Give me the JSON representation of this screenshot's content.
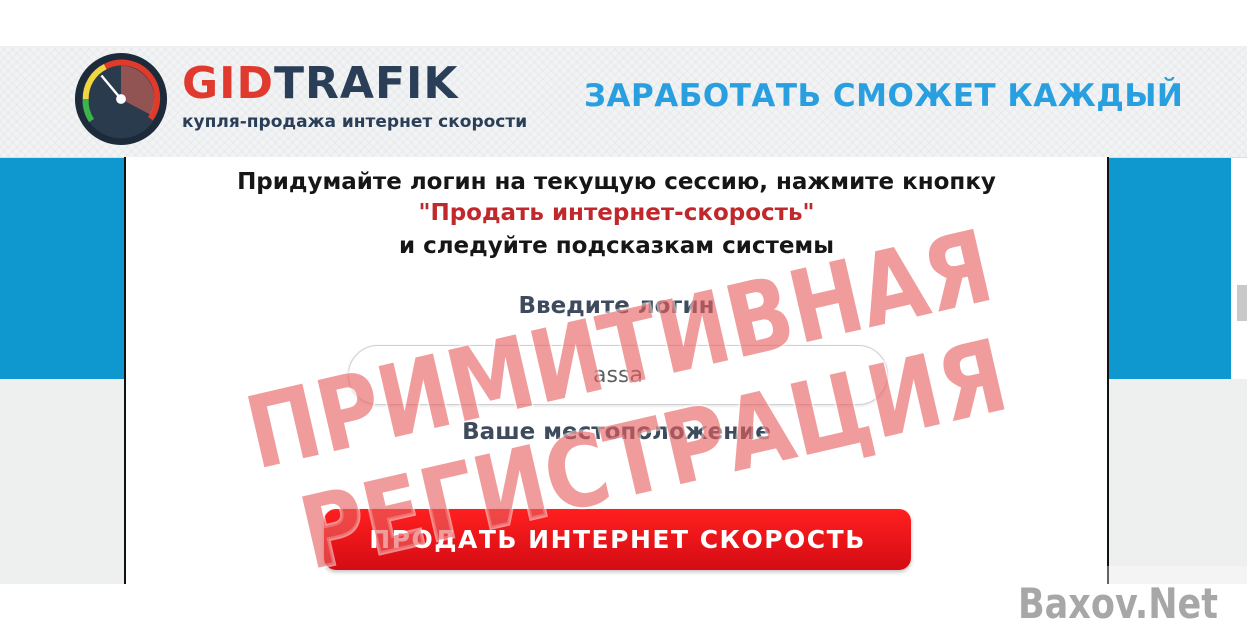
{
  "header": {
    "brand_part1": "GID",
    "brand_part2": "TRAFIK",
    "subtitle": "купля-продажа интернет скорости",
    "tagline": "ЗАРАБОТАТЬ СМОЖЕТ КАЖДЫЙ"
  },
  "instructions": {
    "line1": "Придумайте логин на текущую сессию, нажмите кнопку",
    "line2": "\"Продать интернет-скорость\"",
    "line3": "и следуйте подсказкам системы"
  },
  "form": {
    "login_label": "Введите логин",
    "login_value": "assa",
    "location_label": "Ваше местоположение",
    "submit_label": "ПРОДАТЬ ИНТЕРНЕТ СКОРОСТЬ"
  },
  "overlay": {
    "stamp_line1": "ПРИМИТИВНАЯ",
    "stamp_line2": "РЕГИСТРАЦИЯ",
    "watermark": "Baxov.Net"
  },
  "colors": {
    "brand_red": "#e03a2f",
    "brand_navy": "#2a3e57",
    "tagline_blue": "#2a9fe0",
    "band_blue": "#0f97cf",
    "button_red": "#e8141c",
    "stamp_red": "#e05050"
  },
  "icons": {
    "logo": "speedometer-gauge-icon"
  }
}
